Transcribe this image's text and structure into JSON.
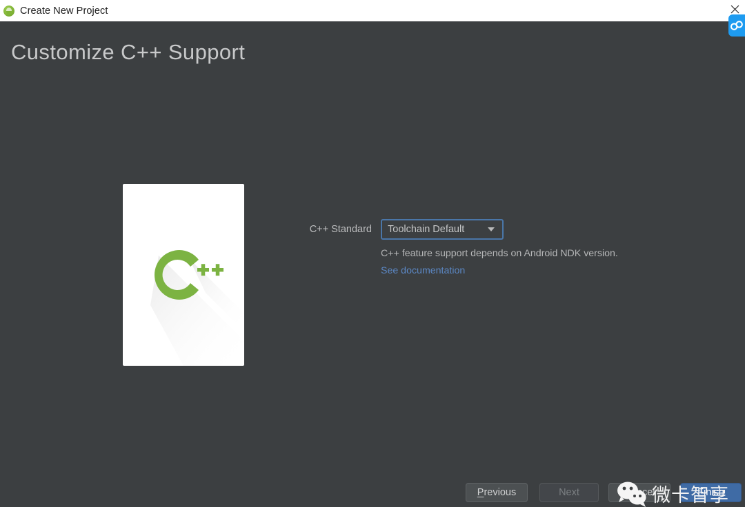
{
  "window": {
    "title": "Create New Project",
    "app_icon": "android-studio-icon",
    "close_icon": "close-icon"
  },
  "page": {
    "title": "Customize C++ Support",
    "background_color": "#3c3f41"
  },
  "illustration": {
    "name": "cpp-logo-illustration",
    "letter": "C",
    "plus_one": "+",
    "plus_two": "+",
    "logo_color": "#7cb342",
    "card_color": "#ffffff"
  },
  "form": {
    "standard_label": "C++ Standard",
    "standard_value": "Toolchain Default",
    "standard_options": [
      "Toolchain Default"
    ],
    "dropdown_icon": "chevron-down-icon",
    "focus_border_color": "#4a76a8",
    "helper_text": "C++ feature support depends on Android NDK version.",
    "doc_link_text": "See documentation",
    "doc_link_color": "#5b87c4"
  },
  "footer": {
    "previous": {
      "pre": "",
      "accel": "P",
      "post": "revious",
      "enabled": true
    },
    "next": {
      "pre": "",
      "accel": "",
      "post": "Next",
      "enabled": false
    },
    "cancel": {
      "pre": "",
      "accel": "C",
      "post": "ancel",
      "enabled": true
    },
    "finish": {
      "pre": "",
      "accel": "F",
      "post": "inish",
      "enabled": true,
      "primary_color": "#3f6ba5"
    }
  },
  "watermark": {
    "text": "微卡智享",
    "logo": "wechat-icon"
  },
  "overlay": {
    "recorder_badge": "recorder-badge-icon",
    "badge_color": "#1e9bf0"
  }
}
